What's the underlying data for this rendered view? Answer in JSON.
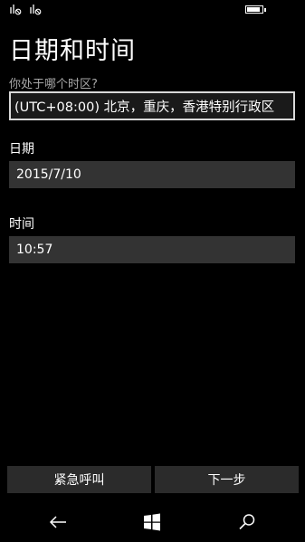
{
  "page": {
    "title": "日期和时间"
  },
  "timezone": {
    "question": "你处于哪个时区?",
    "value": "(UTC+08:00) 北京，重庆，香港特别行政区"
  },
  "date": {
    "label": "日期",
    "value": "2015/7/10"
  },
  "time": {
    "label": "时间",
    "value": "10:57"
  },
  "buttons": {
    "emergency": "紧急呼叫",
    "next": "下一步"
  },
  "icons": {
    "signal_1": "signal-sim1-icon",
    "signal_2": "signal-sim2-icon",
    "battery": "battery-icon",
    "back": "back-arrow-icon",
    "home": "windows-start-icon",
    "search": "search-icon"
  },
  "colors": {
    "background": "#000000",
    "field_bg": "#333333",
    "button_bg": "#2b2b2b",
    "muted_text": "#a7a7a7"
  }
}
